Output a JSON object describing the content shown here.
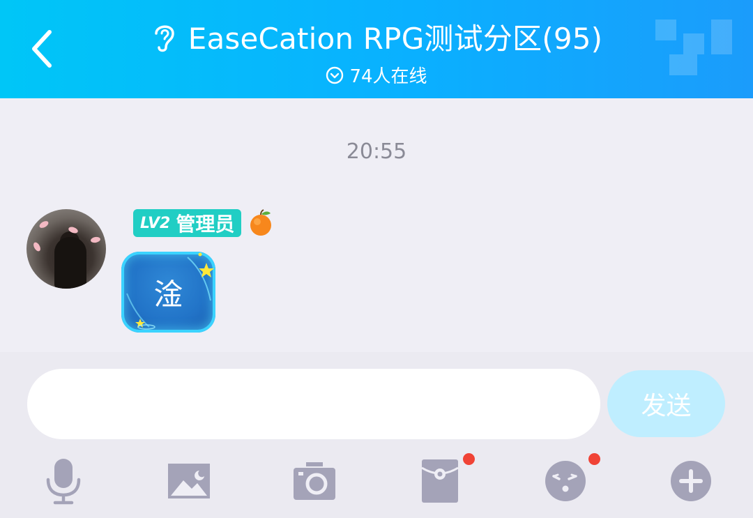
{
  "header": {
    "title": "EaseCation RPG测试分区(95)",
    "online": "74人在线",
    "back_icon": "chevron-left-icon",
    "ear_icon": "ear-icon",
    "online_icon": "chevron-down-circle-icon"
  },
  "chat": {
    "timestamp": "20:55",
    "messages": [
      {
        "level": "LV2",
        "role": "管理员",
        "text": "淦"
      }
    ]
  },
  "composer": {
    "input_value": "",
    "input_placeholder": "",
    "send_label": "发送"
  },
  "toolbar": [
    {
      "name": "voice",
      "icon": "microphone-icon",
      "has_dot": false
    },
    {
      "name": "image",
      "icon": "image-icon",
      "has_dot": false
    },
    {
      "name": "camera",
      "icon": "camera-icon",
      "has_dot": false
    },
    {
      "name": "red-packet",
      "icon": "red-packet-icon",
      "has_dot": true
    },
    {
      "name": "emoji",
      "icon": "emoji-face-icon",
      "has_dot": true
    },
    {
      "name": "more",
      "icon": "plus-circle-icon",
      "has_dot": false
    }
  ],
  "colors": {
    "header_start": "#00c6f7",
    "header_end": "#1b9cfb",
    "badge": "#21cec4",
    "send_button": "#bfeeff",
    "icon_gray": "#a4a3b8",
    "notification_dot": "#f04336"
  }
}
